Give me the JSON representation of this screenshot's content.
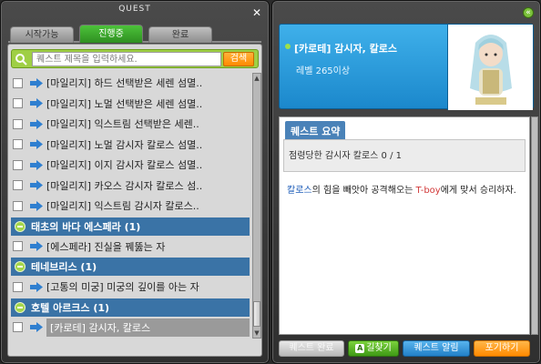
{
  "window_title": "QUEST",
  "tabs": [
    {
      "label": "시작가능",
      "active": false
    },
    {
      "label": "진행중",
      "active": true
    },
    {
      "label": "완료",
      "active": false
    }
  ],
  "search": {
    "placeholder": "퀘스트 제목을 입력하세요.",
    "button": "검색"
  },
  "quests": [
    {
      "type": "item",
      "label": "[마일리지] 하드 선택받은 세렌 섬멸.."
    },
    {
      "type": "item",
      "label": "[마일리지] 노멀 선택받은 세렌 섬멸.."
    },
    {
      "type": "item",
      "label": "[마일리지] 익스트림 선택받은 세렌.."
    },
    {
      "type": "item",
      "label": "[마일리지] 노멀 감시자 칼로스 섬멸.."
    },
    {
      "type": "item",
      "label": "[마일리지] 이지 감시자 칼로스 섬멸.."
    },
    {
      "type": "item",
      "label": "[마일리지] 카오스 감시자 칼로스 섬.."
    },
    {
      "type": "item",
      "label": "[마일리지] 익스트림 감시자 칼로스.."
    },
    {
      "type": "group",
      "label": "태초의 바다 에스페라 (1)"
    },
    {
      "type": "item",
      "label": "[에스페라] 진실을 꿰뚫는 자"
    },
    {
      "type": "group",
      "label": "테네브리스 (1)"
    },
    {
      "type": "item",
      "label": "[고통의 미궁] 미궁의 깊이를 아는 자"
    },
    {
      "type": "group",
      "label": "호텔 아르크스 (1)"
    },
    {
      "type": "item",
      "label": "[카로테] 감시자, 칼로스",
      "selected": true
    }
  ],
  "detail": {
    "npc_name": "[카로테] 감시자, 칼로스",
    "npc_level": "레벨 265이상",
    "summary_tab": "퀘스트 요약",
    "summary_text": "점령당한 감시자 칼로스 0 / 1",
    "desc_name": "칼로스",
    "desc_part1": "의 힘을 빼앗아 공격해오는 ",
    "desc_name2": "T-boy",
    "desc_part2": "에게 맞서 승리하자."
  },
  "buttons": {
    "complete": "퀘스트 완료",
    "find_key": "A",
    "find": "길찾기",
    "alarm": "퀘스트 알림",
    "give_up": "포기하기"
  },
  "colors": {
    "tab_active": "#3fae2a",
    "group_bar": "#3a73a6",
    "npc_card": "#2a9ede",
    "accent_orange": "#ff8a00"
  }
}
